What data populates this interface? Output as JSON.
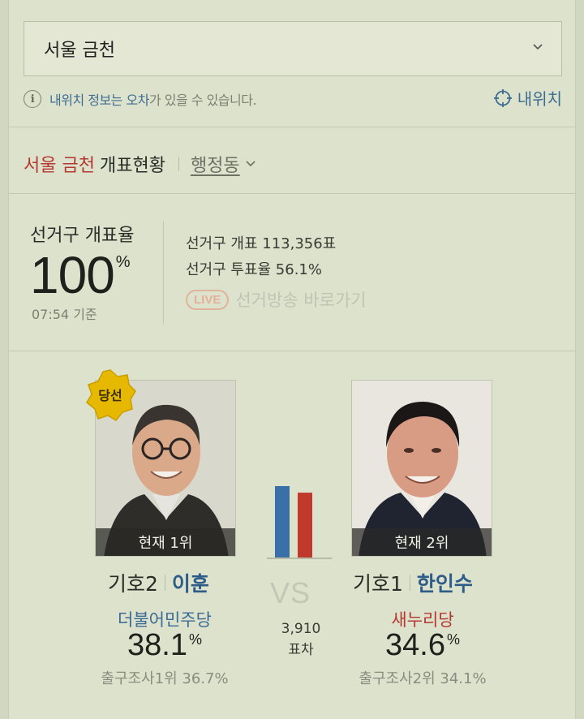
{
  "region_select": {
    "value": "서울 금천"
  },
  "notice": {
    "prefix_blue": "내위치 정보는 오차",
    "suffix": "가 있을 수 있습니다.",
    "my_location": "내위치"
  },
  "result_header": {
    "region": "서울 금천",
    "label": "개표현황",
    "filter": "행정동"
  },
  "count": {
    "title": "선거구 개표율",
    "rate": "100",
    "rate_unit": "%",
    "time": "07:54 기준",
    "stats": [
      "선거구 개표  113,356표",
      "선거구 투표율  56.1%"
    ],
    "live_badge": "LIVE",
    "live_text": "선거방송 바로가기"
  },
  "candidates": [
    {
      "rank": "현재 1위",
      "badge": "당선",
      "number": "기호2",
      "name": "이훈",
      "party": "더불어민주당",
      "party_color": "#3a6a95",
      "vote_rate": "38.1",
      "vote_unit": "%",
      "exit_poll": "출구조사1위 36.7%"
    },
    {
      "rank": "현재 2위",
      "number": "기호1",
      "name": "한인수",
      "party": "새누리당",
      "party_color": "#b4382f",
      "vote_rate": "34.6",
      "vote_unit": "%",
      "exit_poll": "출구조사2위 34.1%"
    }
  ],
  "comparison": {
    "vs": "VS",
    "diff_value": "3,910",
    "diff_label": "표차",
    "bar_colors": [
      "#3a6fa8",
      "#c0392b"
    ],
    "bar_values": [
      38.1,
      34.6
    ]
  },
  "icons": [
    "chevron-down-icon",
    "info-icon",
    "crosshair-icon",
    "winner-badge-icon"
  ]
}
